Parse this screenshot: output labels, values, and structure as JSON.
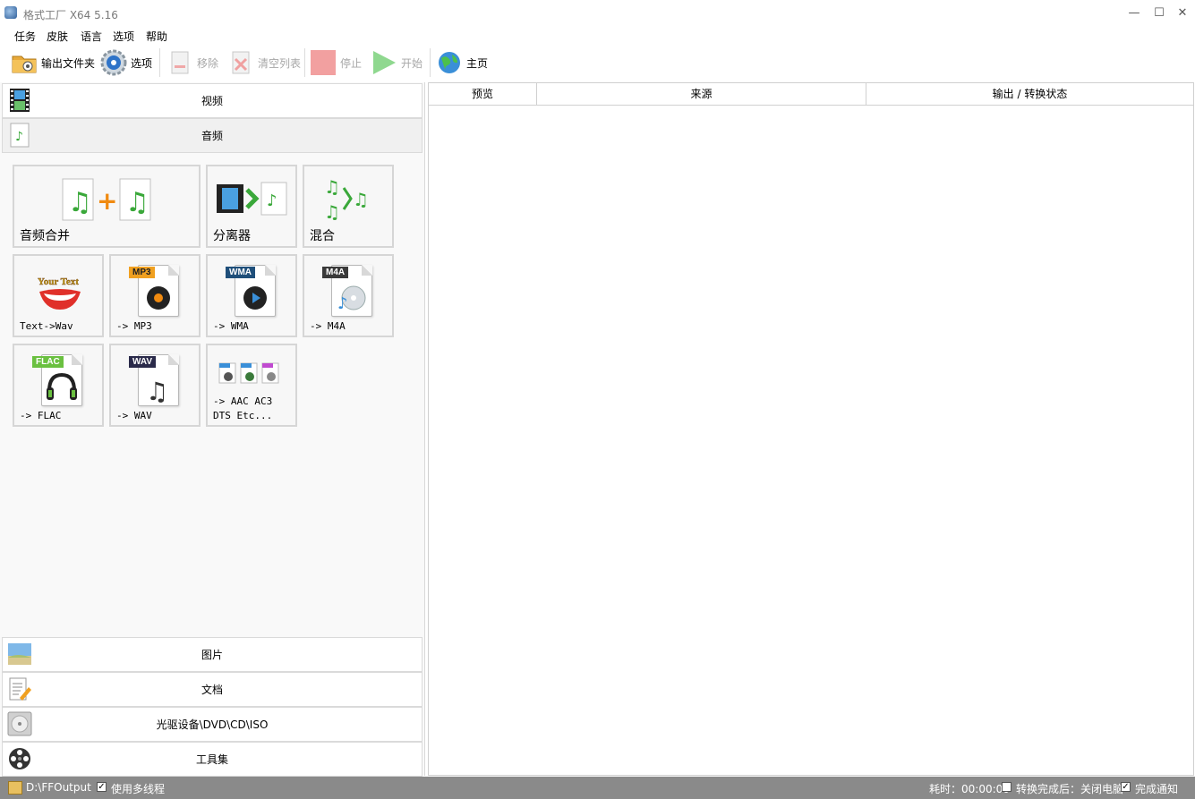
{
  "window": {
    "title": "格式工厂 X64 5.16"
  },
  "menu": {
    "items": [
      "任务",
      "皮肤",
      "语言",
      "选项",
      "帮助"
    ]
  },
  "toolbar": {
    "output_folder": "输出文件夹",
    "options": "选项",
    "remove": "移除",
    "clear_list": "清空列表",
    "stop": "停止",
    "start": "开始",
    "home": "主页"
  },
  "categories": {
    "video": "视频",
    "audio": "音频",
    "picture": "图片",
    "document": "文档",
    "disc": "光驱设备\\DVD\\CD\\ISO",
    "tools": "工具集"
  },
  "audio_tiles": {
    "merge": "音频合并",
    "splitter": "分离器",
    "mix": "混合",
    "text_to_wav": "Text->Wav",
    "to_mp3": "-> MP3",
    "to_wma": "-> WMA",
    "to_m4a": "-> M4A",
    "to_flac": "-> FLAC",
    "to_wav": "-> WAV",
    "to_aac_line1": "-> AAC AC3",
    "to_aac_line2": "DTS Etc..."
  },
  "badges": {
    "mp3": "MP3",
    "wma": "WMA",
    "m4a": "M4A",
    "flac": "FLAC",
    "wav": "WAV",
    "your_text": "Your Text"
  },
  "table": {
    "columns": [
      "预览",
      "来源",
      "输出 / 转换状态"
    ]
  },
  "status": {
    "output_path": "D:\\FFOutput",
    "multithread": "使用多线程",
    "elapsed": "耗时：00:00:00",
    "after_convert": "转换完成后：关闭电脑",
    "notify": "完成通知"
  },
  "colors": {
    "accent_green": "#3aa83a",
    "status_bar": "#8a8a8a",
    "stop_red": "#f2a0a0",
    "start_green": "#8fd88f"
  }
}
